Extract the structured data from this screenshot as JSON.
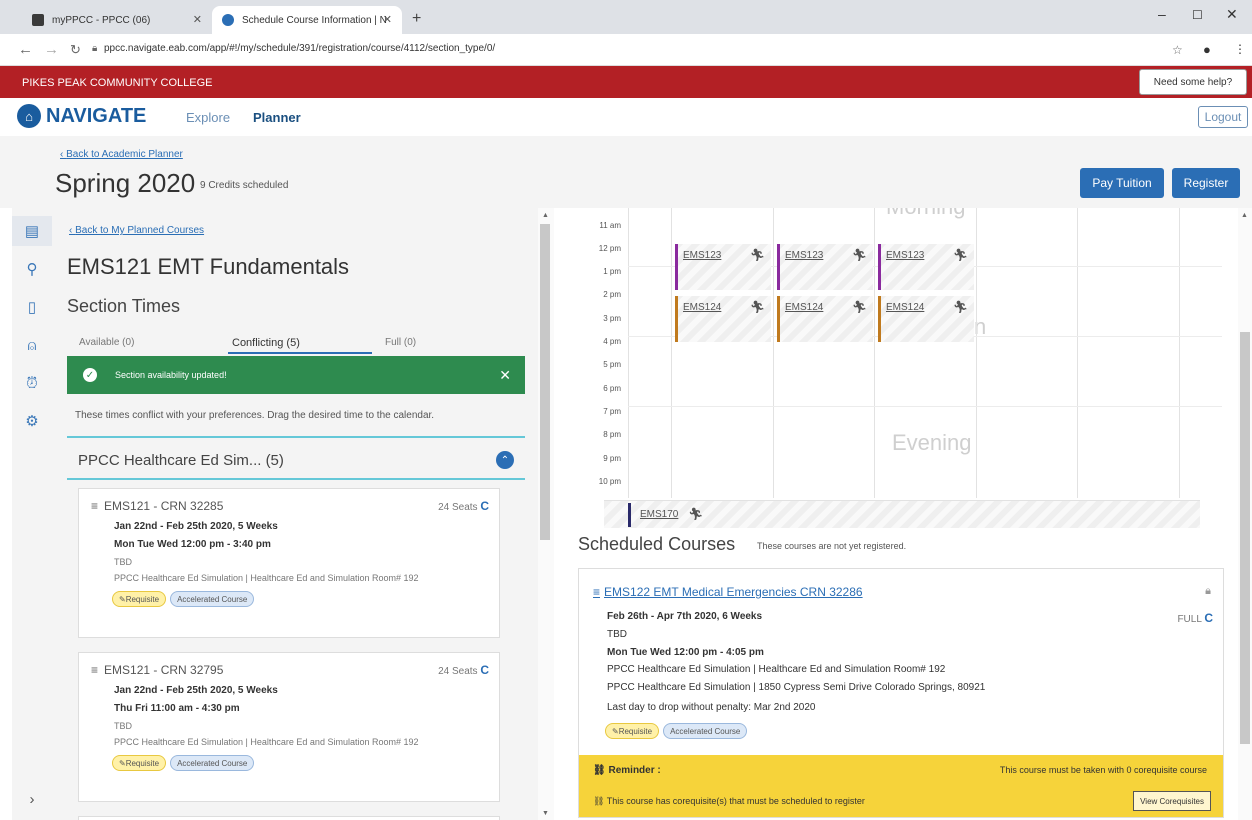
{
  "browser": {
    "tabs": [
      {
        "title": "myPPCC - PPCC (06)"
      },
      {
        "title": "Schedule Course Information | N"
      }
    ],
    "url": "ppcc.navigate.eab.com/app/#!/my/schedule/391/registration/course/4112/section_type/0/"
  },
  "site": {
    "college": "PIKES PEAK COMMUNITY COLLEGE",
    "help": "Need some help?",
    "logo": "NAVIGATE",
    "nav": {
      "explore": "Explore",
      "planner": "Planner"
    },
    "logout": "Logout"
  },
  "header": {
    "back": "Back to Academic Planner",
    "term": "Spring 2020",
    "credits": "9 Credits scheduled",
    "pay": "Pay Tuition",
    "register": "Register"
  },
  "left": {
    "back": "Back to My Planned Courses",
    "course_title": "EMS121 EMT Fundamentals",
    "section_times": "Section Times",
    "tabs": [
      "Available (0)",
      "Conflicting (5)",
      "Full (0)"
    ],
    "toast": "Section availability updated!",
    "note": "These times conflict with your preferences. Drag the desired time to the calendar.",
    "group": "PPCC Healthcare Ed Sim... (5)",
    "cards": [
      {
        "title": "EMS121 - CRN 32285",
        "seats": "24 Seats",
        "dates": "Jan 22nd - Feb 25th 2020, 5 Weeks",
        "times": "Mon Tue Wed 12:00 pm - 3:40 pm",
        "instructor": "TBD",
        "location": "PPCC Healthcare Ed Simulation | Healthcare Ed and Simulation Room# 192",
        "badges": [
          "Requisite",
          "Accelerated Course"
        ]
      },
      {
        "title": "EMS121 - CRN 32795",
        "seats": "24 Seats",
        "dates": "Jan 22nd - Feb 25th 2020, 5 Weeks",
        "times": "Thu Fri 11:00 am - 4:30 pm",
        "instructor": "TBD",
        "location": "PPCC Healthcare Ed Simulation | Healthcare Ed and Simulation Room# 192",
        "badges": [
          "Requisite",
          "Accelerated Course"
        ]
      }
    ]
  },
  "calendar": {
    "hours": [
      "11 am",
      "12 pm",
      "1 pm",
      "2 pm",
      "3 pm",
      "4 pm",
      "5 pm",
      "6 pm",
      "7 pm",
      "8 pm",
      "9 pm",
      "10 pm"
    ],
    "watermarks": {
      "morning": "Morning",
      "afternoon": "n",
      "evening": "Evening"
    },
    "events": {
      "ems123": "EMS123",
      "ems124": "EMS124",
      "ems170": "EMS170"
    },
    "colors": {
      "ems123": "#8a2a9e",
      "ems124": "#c07a1e",
      "ems170": "#2a2a6a"
    }
  },
  "scheduled": {
    "title": "Scheduled Courses",
    "note": "These courses are not yet registered.",
    "card": {
      "title": "EMS122 EMT Medical Emergencies CRN 32286",
      "status": "FULL",
      "dates": "Feb 26th - Apr 7th 2020, 6 Weeks",
      "instructor": "TBD",
      "times": "Mon Tue Wed 12:00 pm - 4:05 pm",
      "location1": "PPCC Healthcare Ed Simulation | Healthcare Ed and Simulation Room# 192",
      "location2": "PPCC Healthcare Ed Simulation | 1850 Cypress Semi Drive Colorado Springs, 80921",
      "drop": "Last day to drop without penalty: Mar 2nd 2020",
      "badges": [
        "Requisite",
        "Accelerated Course"
      ]
    },
    "reminder": {
      "title": "Reminder :",
      "right": "This course must be taken with 0 corequisite course",
      "line": "This course has corequisite(s) that must be scheduled to register",
      "button": "View Corequisites"
    }
  }
}
